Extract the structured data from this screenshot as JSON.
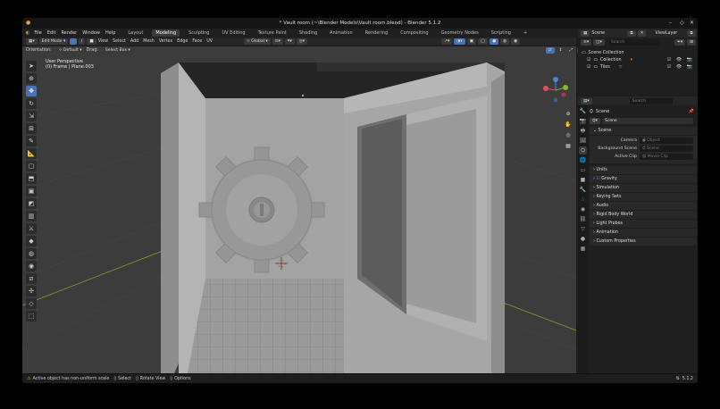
{
  "window": {
    "title": "* Vault room (~\\Blender Models\\Vault room.blend) - Blender 5.1.2"
  },
  "menu": [
    "File",
    "Edit",
    "Render",
    "Window",
    "Help"
  ],
  "workspaces": [
    "Layout",
    "Modeling",
    "Sculpting",
    "UV Editing",
    "Texture Paint",
    "Shading",
    "Animation",
    "Rendering",
    "Compositing",
    "Geometry Nodes",
    "Scripting"
  ],
  "active_workspace": "Modeling",
  "viewport_header": {
    "mode": "Edit Mode",
    "menus": [
      "View",
      "Select",
      "Add",
      "Mesh",
      "Vertex",
      "Edge",
      "Face",
      "UV"
    ],
    "transform": "Global"
  },
  "tool_header": {
    "orientation_label": "Orientation:",
    "orientation_value": "Default",
    "drag_label": "Drag:",
    "drag_value": "Select Box",
    "options": "Options"
  },
  "overlay_text": {
    "line1": "User Perspective",
    "line2": "(0) Frame | Plane.003"
  },
  "gizmo": {
    "x": "X",
    "y": "Y",
    "z": "Z"
  },
  "outliner": {
    "header": {
      "scene": "Scene",
      "view_layer": "ViewLayer",
      "search": "Search"
    },
    "items": [
      {
        "label": "Scene Collection",
        "selected": false,
        "indent": 0
      },
      {
        "label": "Collection",
        "selected": false,
        "indent": 1
      },
      {
        "label": "Tiles",
        "selected": false,
        "indent": 1
      }
    ]
  },
  "properties": {
    "search": "Search",
    "breadcrumb": "Scene",
    "datablock": "Scene",
    "section": "Scene",
    "fields": [
      {
        "label": "Camera",
        "value": "Object"
      },
      {
        "label": "Background Scene",
        "value": "Scene"
      },
      {
        "label": "Active Clip",
        "value": "Movie Clip"
      }
    ],
    "panels": [
      "Units",
      "Gravity",
      "Simulation",
      "Keying Sets",
      "Audio",
      "Rigid Body World",
      "Light Probes",
      "Animation",
      "Custom Properties"
    ]
  },
  "status_bar": {
    "warning": "Active object has non-uniform scale",
    "select": "Select",
    "rotate": "Rotate View",
    "options": "Options",
    "version": "5.1.2"
  },
  "colors": {
    "accent": "#4772b3",
    "viewport": "#3c3c3c",
    "panel": "#282828",
    "x_axis": "#e0505a",
    "y_axis": "#84b52e",
    "z_axis": "#4a84d6"
  }
}
